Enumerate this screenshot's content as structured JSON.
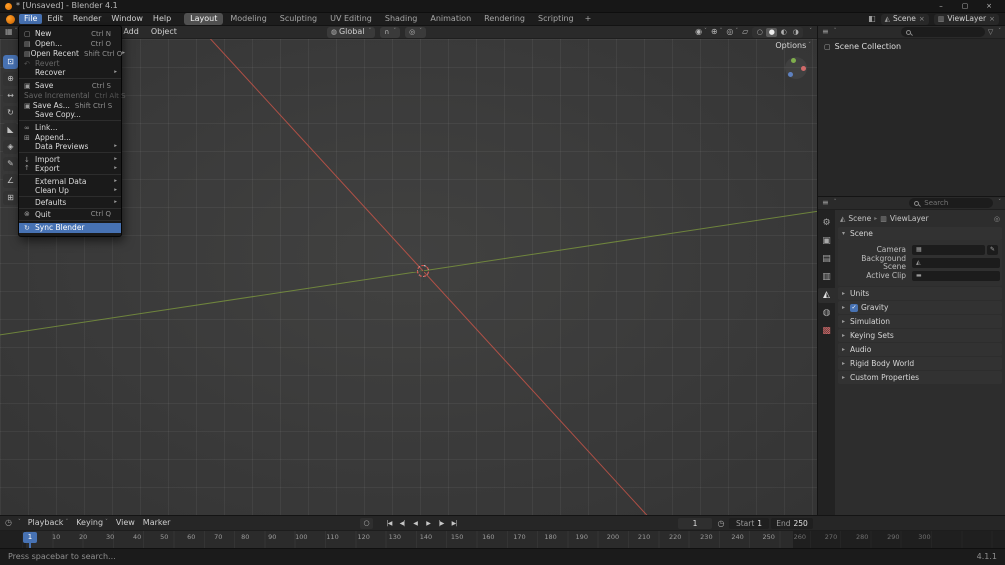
{
  "window": {
    "title": "* [Unsaved] - Blender 4.1",
    "version": "4.1.1",
    "status_hint": "Press spacebar to search..."
  },
  "icons": {
    "chevron_down": "˅",
    "chevron_right": "▸",
    "caret_down": "▾",
    "check": "✓",
    "close": "×",
    "minimize": "–",
    "maximize": "▢",
    "editor_viewport": "▦",
    "editor_outliner": "≡",
    "editor_properties": "≡",
    "editor_timeline": "◷",
    "orientation_globe": "◍",
    "magnet": "∩",
    "proportional": "◎",
    "collection": "▢",
    "filter": "▽",
    "pin": "◎",
    "eyedropper": "✎",
    "record": "○",
    "stopwatch": "◷",
    "scene_block": "◭",
    "viewlayer_block": "▥",
    "screen_layout": "◧"
  },
  "menubar": {
    "menus": [
      {
        "label": "File",
        "open": true
      },
      {
        "label": "Edit"
      },
      {
        "label": "Render"
      },
      {
        "label": "Window"
      },
      {
        "label": "Help"
      }
    ],
    "workspaces": [
      {
        "label": "Layout",
        "active": true
      },
      {
        "label": "Modeling"
      },
      {
        "label": "Sculpting"
      },
      {
        "label": "UV Editing"
      },
      {
        "label": "Shading"
      },
      {
        "label": "Animation"
      },
      {
        "label": "Rendering"
      },
      {
        "label": "Scripting"
      }
    ],
    "add_workspace_label": "+",
    "scene_chip": "Scene",
    "viewlayer_chip": "ViewLayer"
  },
  "file_menu": {
    "items": [
      {
        "name": "new",
        "label": "New",
        "shortcut": "Ctrl N",
        "icon": "▢"
      },
      {
        "name": "open",
        "label": "Open...",
        "shortcut": "Ctrl O",
        "icon": "▤"
      },
      {
        "name": "open-recent",
        "label": "Open Recent",
        "shortcut": "Shift Ctrl O",
        "icon": "▤",
        "submenu": true
      },
      {
        "name": "revert",
        "label": "Revert",
        "icon": "↶",
        "disabled": true
      },
      {
        "name": "recover",
        "label": "Recover",
        "submenu": true,
        "sep_after": true
      },
      {
        "name": "save",
        "label": "Save",
        "shortcut": "Ctrl S",
        "icon": "▣"
      },
      {
        "name": "save-incremental",
        "label": "Save Incremental",
        "shortcut": "Ctrl Alt S",
        "disabled": true
      },
      {
        "name": "save-as",
        "label": "Save As...",
        "shortcut": "Shift Ctrl S",
        "icon": "▣"
      },
      {
        "name": "save-copy",
        "label": "Save Copy...",
        "sep_after": true
      },
      {
        "name": "link",
        "label": "Link...",
        "icon": "∞"
      },
      {
        "name": "append",
        "label": "Append...",
        "icon": "⊞"
      },
      {
        "name": "data-previews",
        "label": "Data Previews",
        "submenu": true,
        "sep_after": true
      },
      {
        "name": "import",
        "label": "Import",
        "icon": "↓",
        "submenu": true
      },
      {
        "name": "export",
        "label": "Export",
        "icon": "↑",
        "submenu": true,
        "sep_after": true
      },
      {
        "name": "external-data",
        "label": "External Data",
        "submenu": true
      },
      {
        "name": "clean-up",
        "label": "Clean Up",
        "submenu": true,
        "sep_after": true
      },
      {
        "name": "defaults",
        "label": "Defaults",
        "submenu": true,
        "sep_after": true
      },
      {
        "name": "quit",
        "label": "Quit",
        "shortcut": "Ctrl Q",
        "icon": "⊗",
        "sep_after": true
      },
      {
        "name": "sync-blender",
        "label": "Sync Blender",
        "icon": "↻",
        "highlighted": true
      }
    ]
  },
  "viewport": {
    "header": {
      "add_label": "Add",
      "object_label": "Object",
      "orientation_label": "Global",
      "options_label": "Options"
    },
    "header_icons": [
      {
        "name": "visibility-toggle",
        "icon": "◉",
        "chevron": true
      },
      {
        "name": "gizmos-toggle",
        "icon": "⊕",
        "chevron": true
      },
      {
        "name": "overlays-toggle",
        "icon": "◎",
        "chevron": true
      },
      {
        "name": "xray-toggle",
        "icon": "▱"
      }
    ],
    "shading_modes": [
      {
        "name": "wireframe",
        "icon": "○"
      },
      {
        "name": "solid",
        "icon": "●",
        "active": true
      },
      {
        "name": "material-preview",
        "icon": "◐"
      },
      {
        "name": "rendered",
        "icon": "◑"
      }
    ],
    "toolbar": [
      {
        "name": "select-box",
        "icon": "⊡",
        "active": true
      },
      {
        "name": "cursor",
        "icon": "⊕"
      },
      {
        "name": "move",
        "icon": "↔"
      },
      {
        "name": "rotate",
        "icon": "↻"
      },
      {
        "name": "scale",
        "icon": "◣"
      },
      {
        "name": "transform",
        "icon": "◈"
      },
      {
        "name": "annotate",
        "icon": "✎"
      },
      {
        "name": "measure",
        "icon": "∠"
      },
      {
        "name": "add-cube",
        "icon": "⊞"
      }
    ]
  },
  "outliner": {
    "search_placeholder": "",
    "root_item": "Scene Collection"
  },
  "properties": {
    "search_placeholder": "Search",
    "breadcrumb": {
      "scene": "Scene",
      "viewlayer": "ViewLayer"
    },
    "tabs": [
      {
        "name": "tool",
        "icon": "⚙",
        "color": "#a8a8a8"
      },
      {
        "name": "render",
        "icon": "▣",
        "color": "#a8a8a8"
      },
      {
        "name": "output",
        "icon": "▤",
        "color": "#a8a8a8"
      },
      {
        "name": "view-layer",
        "icon": "▥",
        "color": "#a8a8a8"
      },
      {
        "name": "scene",
        "icon": "◭",
        "active": true,
        "color": "#e2e2e2"
      },
      {
        "name": "world",
        "icon": "◍",
        "color": "#a8a8a8"
      },
      {
        "name": "texture",
        "icon": "▩",
        "color": "#cf6a6a"
      }
    ],
    "scene_panel": {
      "title": "Scene",
      "rows": [
        {
          "name": "camera",
          "label": "Camera",
          "icon": "▦",
          "dropper": true
        },
        {
          "name": "background-scene",
          "label": "Background Scene",
          "icon": "◭"
        },
        {
          "name": "active-clip",
          "label": "Active Clip",
          "icon": "▬"
        }
      ]
    },
    "collapsed_panels": [
      {
        "name": "units",
        "label": "Units"
      },
      {
        "name": "gravity",
        "label": "Gravity",
        "checkbox": true,
        "checked": true
      },
      {
        "name": "simulation",
        "label": "Simulation"
      },
      {
        "name": "keying-sets",
        "label": "Keying Sets"
      },
      {
        "name": "audio",
        "label": "Audio"
      },
      {
        "name": "rigid-body-world",
        "label": "Rigid Body World"
      },
      {
        "name": "custom-properties",
        "label": "Custom Properties"
      }
    ]
  },
  "timeline": {
    "menus": [
      {
        "label": "Playback",
        "chevron": true
      },
      {
        "label": "Keying",
        "chevron": true
      },
      {
        "label": "View"
      },
      {
        "label": "Marker"
      }
    ],
    "transport": [
      {
        "name": "jump-to-start",
        "glyph": "|◀"
      },
      {
        "name": "prev-keyframe",
        "glyph": "◀|"
      },
      {
        "name": "play-reverse",
        "glyph": "◀"
      },
      {
        "name": "play",
        "glyph": "▶"
      },
      {
        "name": "next-keyframe",
        "glyph": "|▶"
      },
      {
        "name": "jump-to-end",
        "glyph": "▶|"
      }
    ],
    "current_frame": "1",
    "playhead_frame": "1",
    "start_label": "Start",
    "start_value": "1",
    "end_label": "End",
    "end_value": "250",
    "ruler": [
      10,
      20,
      30,
      40,
      50,
      60,
      70,
      80,
      90,
      100,
      110,
      120,
      130,
      140,
      150,
      160,
      170,
      180,
      190,
      200,
      210,
      220,
      230,
      240,
      250,
      260,
      270,
      280,
      290,
      300
    ]
  }
}
